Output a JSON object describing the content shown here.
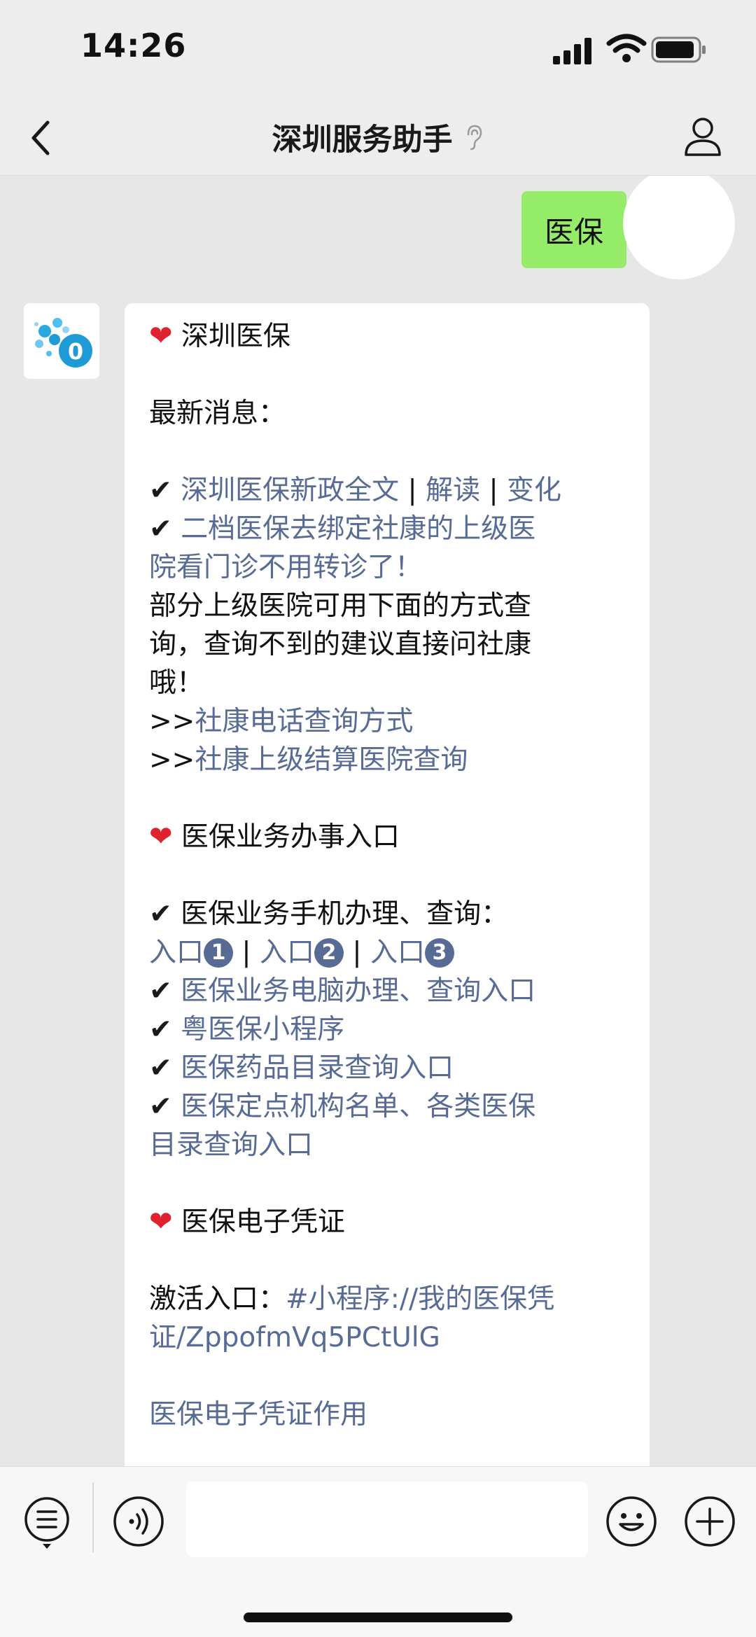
{
  "status_bar": {
    "time": "14:26"
  },
  "nav": {
    "title": "深圳服务助手"
  },
  "sent": {
    "text": "医保"
  },
  "message": {
    "section1_title": "深圳医保",
    "latest_label": "最新消息：",
    "news1_link1": "深圳医保新政全文",
    "sep": "|",
    "news1_link2": "解读",
    "news1_link3": "变化",
    "news2_line1": "二档医保去绑定社康的上级医",
    "news2_line2": "院看门诊不用转诊了！",
    "body_line1": "部分上级医院可用下面的方式查",
    "body_line2": "询，查询不到的建议直接问社康",
    "body_line3": "哦！",
    "arrow": ">>",
    "query_link1": "社康电话查询方式",
    "query_link2": "社康上级结算医院查询",
    "section2_title": "医保业务办事入口",
    "mobile_label": "医保业务手机办理、查询：",
    "entry_label": "入口",
    "entry_nums": [
      "1",
      "2",
      "3"
    ],
    "pc_link": "医保业务电脑办理、查询入口",
    "miniprogram_link": "粤医保小程序",
    "drug_link": "医保药品目录查询入口",
    "org_link_line1": "医保定点机构名单、各类医保",
    "org_link_line2": "目录查询入口",
    "section3_title": "医保电子凭证",
    "activate_label": "激活入口：",
    "activate_link_line1": "#小程序://我的医保凭",
    "activate_link_line2": "证/ZppofmVq5PCtUlG",
    "voucher_use_link": "医保电子凭证作用"
  },
  "icons": {
    "heart": "heart-icon",
    "check": "check-icon",
    "back": "chevron-left-icon",
    "profile": "person-icon",
    "ear": "ear-icon",
    "menu": "menu-list-icon",
    "voice": "voice-icon",
    "emoji": "emoji-icon",
    "plus": "plus-icon"
  },
  "colors": {
    "link": "#576b95",
    "sent_bubble": "#95ec69",
    "heart": "#e0222e",
    "chat_bg": "#e7e7e7"
  }
}
